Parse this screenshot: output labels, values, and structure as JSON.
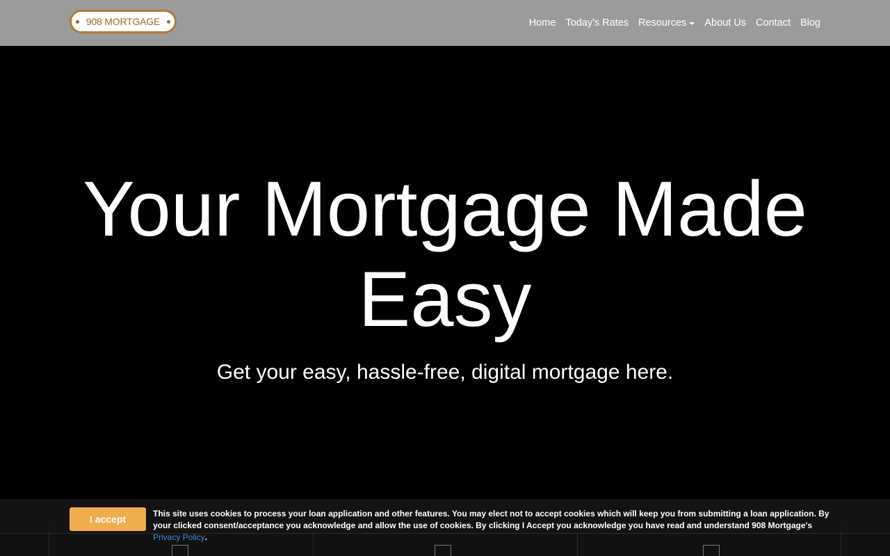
{
  "brand": {
    "logo_text": "908 MORTGAGE"
  },
  "nav": {
    "home": "Home",
    "rates": "Today's Rates",
    "resources": "Resources",
    "about": "About Us",
    "contact": "Contact",
    "blog": "Blog"
  },
  "hero": {
    "title": "Your Mortgage Made Easy",
    "subtitle": "Get your easy, hassle-free, digital mortgage here."
  },
  "cookie": {
    "button": "I accept",
    "text": "This site uses cookies to process your loan application and other features. You may elect not to accept cookies which will keep you from submitting a loan application. By your clicked consent/acceptance you acknowledge and allow the use of cookies. By clicking I Accept you acknowledge you have read and understand 908 Mortgage's ",
    "link": "Privacy Policy",
    "end": "."
  },
  "colors": {
    "navbar": "#9b9b9b",
    "accent": "#f0ad4e",
    "logo_border": "#b07a34",
    "link": "#3b8fd6"
  }
}
